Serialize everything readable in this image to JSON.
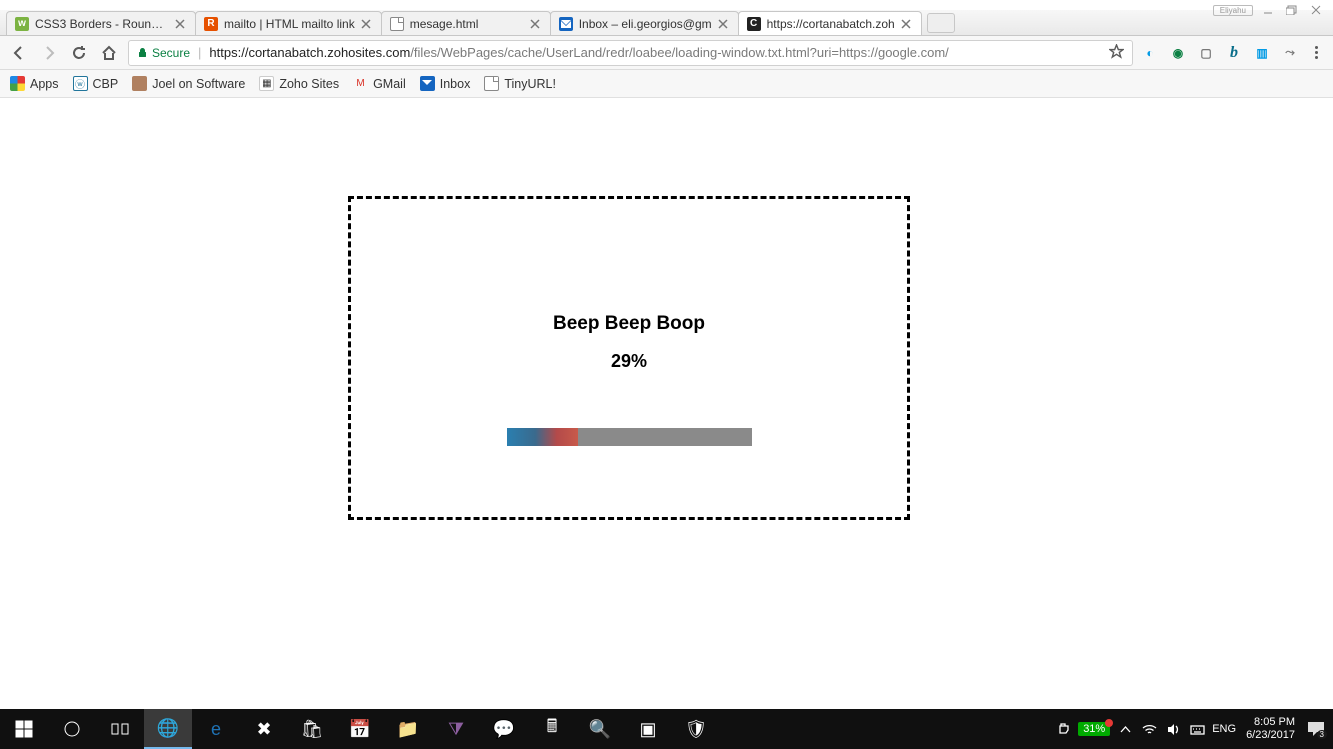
{
  "window": {
    "user_label": "Eliyahu"
  },
  "tabs": [
    {
      "label": "CSS3 Borders - Rounded"
    },
    {
      "label": "mailto | HTML mailto link"
    },
    {
      "label": "mesage.html"
    },
    {
      "label": "Inbox – eli.georgios@gm"
    },
    {
      "label": "https://cortanabatch.zoh"
    }
  ],
  "address": {
    "secure_label": "Secure",
    "host": "https://cortanabatch.zohosites.com",
    "path": "/files/WebPages/cache/UserLand/redr/loabee/loading-window.txt.html?uri=https://google.com/"
  },
  "bookmarks": {
    "apps": "Apps",
    "cbp": "CBP",
    "joel": "Joel on Software",
    "zoho": "Zoho Sites",
    "gmail": "GMail",
    "inbox": "Inbox",
    "tiny": "TinyURL!"
  },
  "loader": {
    "title": "Beep Beep Boop",
    "percent_text": "29%",
    "percent_value": 29
  },
  "taskbar": {
    "battery_pct": "31%",
    "lang": "ENG",
    "time": "8:05 PM",
    "date": "6/23/2017",
    "notif_count": "3"
  }
}
